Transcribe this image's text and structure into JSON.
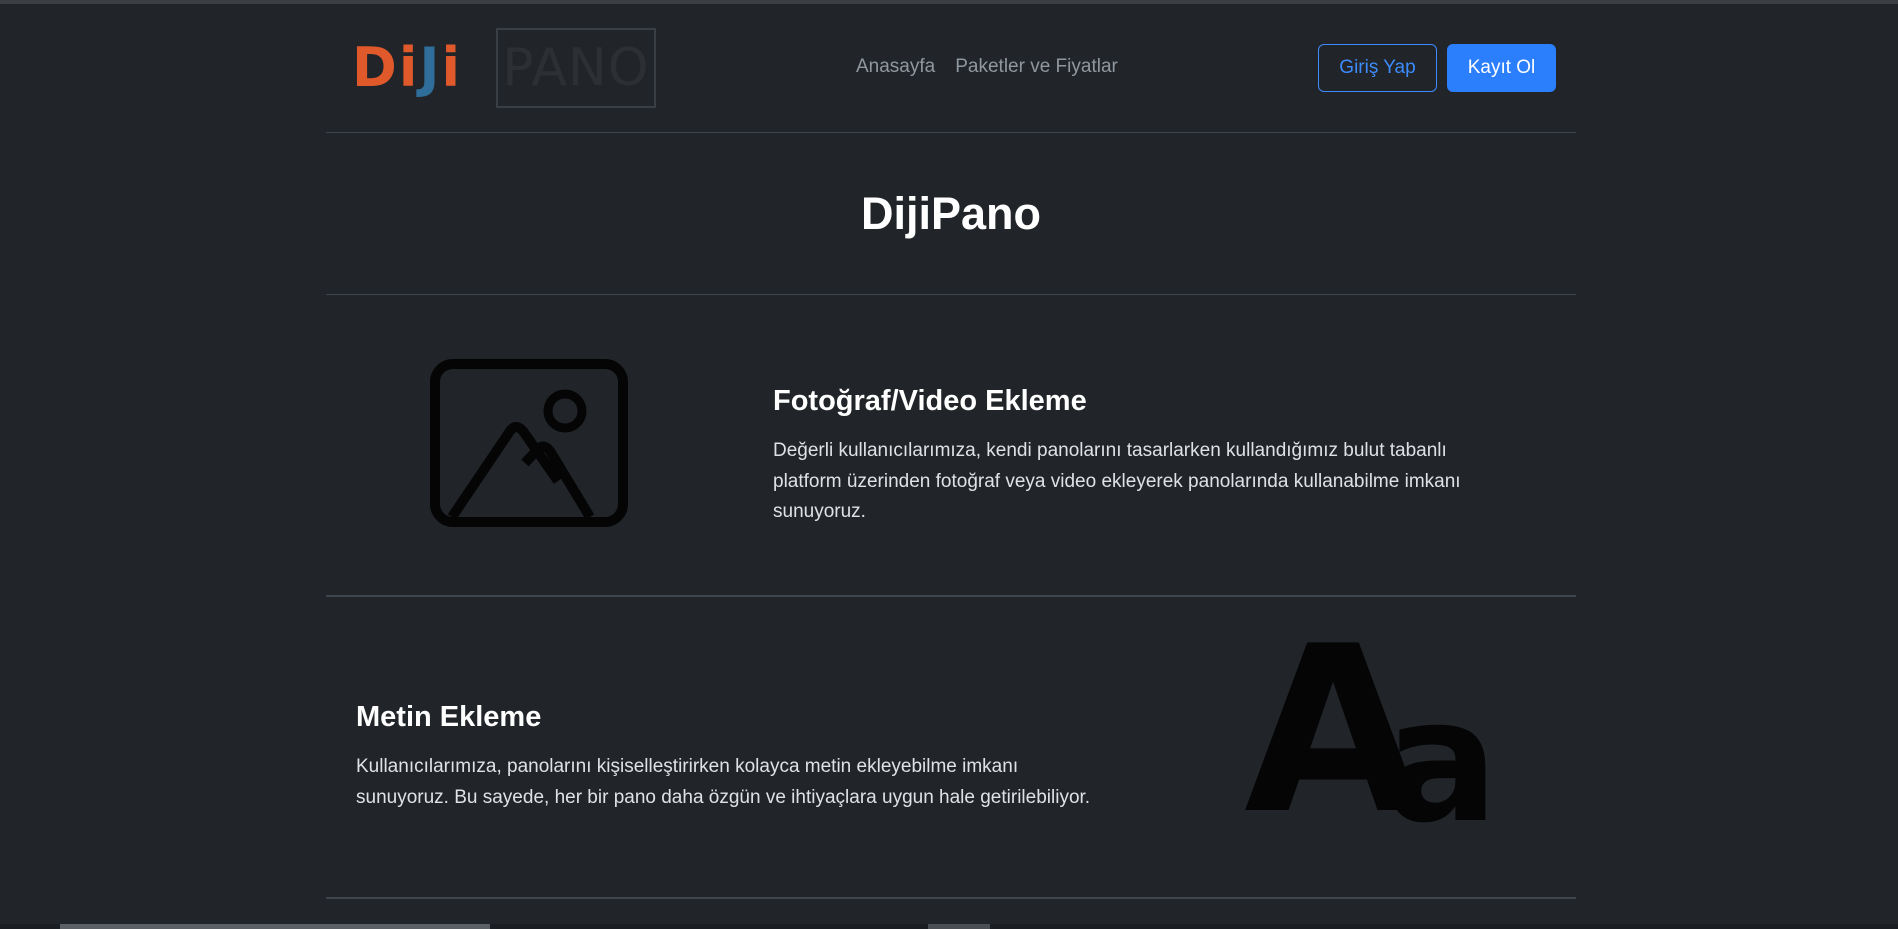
{
  "header": {
    "logo": {
      "part1": "DiJi",
      "part2": "PANO"
    },
    "nav": [
      {
        "label": "Anasayfa"
      },
      {
        "label": "Paketler ve Fiyatlar"
      }
    ],
    "login_label": "Giriş Yap",
    "signup_label": "Kayıt Ol"
  },
  "hero": {
    "title": "DijiPano"
  },
  "features": [
    {
      "title": "Fotoğraf/Video Ekleme",
      "lines": [
        "Değerli kullanıcılarımıza, kendi panolarını tasarlarken kullandığımız bulut tabanlı",
        "platform üzerinden fotoğraf veya video ekleyerek panolarında kullanabilme imkanı",
        "sunuyoruz."
      ],
      "icon": "image-icon"
    },
    {
      "title": "Metin Ekleme",
      "lines": [
        "Kullanıcılarımıza, panolarını kişiselleştirirken kolayca metin ekleyebilme imkanı",
        "sunuyoruz. Bu sayede, her bir pano daha özgün ve ihtiyaçlara uygun hale getirilebiliyor."
      ],
      "icon": "text-aa-icon",
      "icon_text": {
        "big": "A",
        "small": "a"
      }
    }
  ],
  "colors": {
    "background": "#212529",
    "primary": "#2c7ffc",
    "logo_orange": "#e0592a",
    "logo_blue": "#2f6d9b"
  }
}
